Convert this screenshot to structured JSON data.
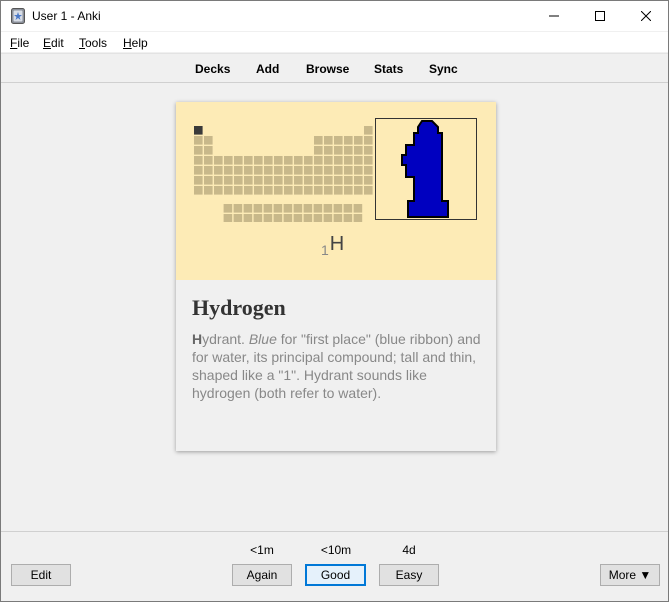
{
  "window": {
    "title": "User 1 - Anki",
    "controls": {
      "minimize": "minimize-icon",
      "maximize": "maximize-icon",
      "close": "close-icon"
    }
  },
  "menu": [
    {
      "accel": "F",
      "rest": "ile"
    },
    {
      "accel": "E",
      "rest": "dit"
    },
    {
      "accel": "T",
      "rest": "ools"
    },
    {
      "accel": "H",
      "rest": "elp"
    }
  ],
  "toolbar": {
    "items": [
      "Decks",
      "Add",
      "Browse",
      "Stats",
      "Sync"
    ]
  },
  "card": {
    "symbol_number": "1",
    "symbol": "H",
    "title": "Hydrogen",
    "body_first_letter": "H",
    "body_part1": "ydrant. ",
    "body_italic": "Blue",
    "body_part2": " for \"first place\" (blue ribbon) and for water, its principal compound; tall and thin, shaped like a \"1\". Hydrant sounds like hydrogen (both refer to water).",
    "colors": {
      "top_background": "#fdebb6",
      "table_cell": "#c8b88a",
      "highlight_cell": "#3a3a3a",
      "hydrant": "#0000c0"
    }
  },
  "review": {
    "edit_label": "Edit",
    "more_label": "More ▼",
    "answers": [
      {
        "time": "<1m",
        "label": "Again"
      },
      {
        "time": "<10m",
        "label": "Good"
      },
      {
        "time": "4d",
        "label": "Easy"
      }
    ]
  }
}
